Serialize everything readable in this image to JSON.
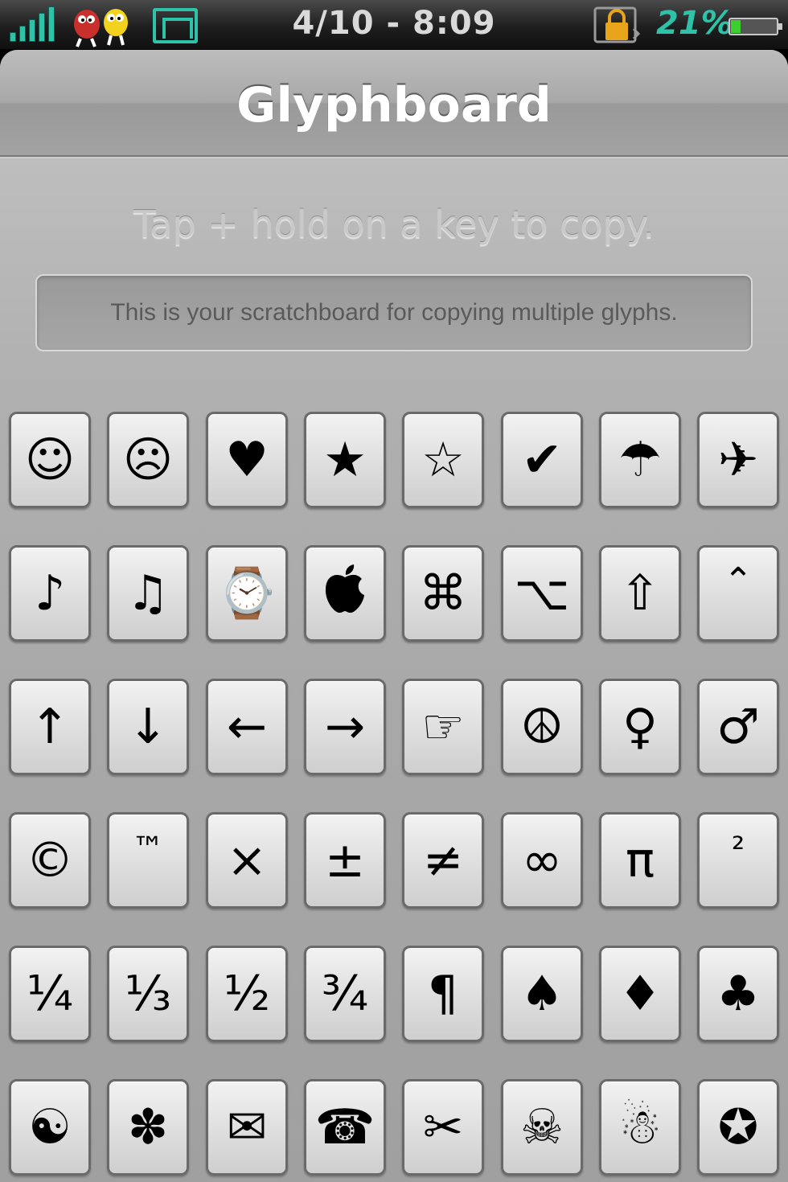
{
  "status_bar": {
    "time": "4/10 - 8:09",
    "battery_percent_text": "21%",
    "battery_level": 0.21,
    "icons": [
      "signal-bars-icon",
      "mm-characters-icon",
      "screen-mirror-icon",
      "lock-rotation-icon",
      "battery-icon"
    ],
    "accent_color": "#2ec2a8"
  },
  "app": {
    "title": "Glyphboard",
    "hint": "Tap + hold on a key to copy.",
    "scratchboard_placeholder": "This is your scratchboard for copying multiple glyphs."
  },
  "keys": [
    [
      "☺",
      "☹",
      "♥",
      "★",
      "☆",
      "✔",
      "☂",
      "✈"
    ],
    [
      "♪",
      "♫",
      "⌚",
      "",
      "⌘",
      "⌥",
      "⇧",
      "⌃"
    ],
    [
      "↑",
      "↓",
      "←",
      "→",
      "☞",
      "☮",
      "♀",
      "♂"
    ],
    [
      "©",
      "™",
      "×",
      "±",
      "≠",
      "∞",
      "π",
      "²"
    ],
    [
      "¼",
      "⅓",
      "½",
      "¾",
      "¶",
      "♠",
      "♦",
      "♣"
    ],
    [
      "☯",
      "✽",
      "✉",
      "☎",
      "✂",
      "☠",
      "☃",
      "✪"
    ]
  ],
  "key_names": [
    [
      "smile-face",
      "frown-face",
      "heart",
      "black-star",
      "white-star",
      "check-mark",
      "umbrella",
      "airplane"
    ],
    [
      "eighth-note",
      "beamed-notes",
      "watch",
      "apple-logo",
      "command",
      "option",
      "shift-arrow",
      "control-caret"
    ],
    [
      "up-arrow",
      "down-arrow",
      "left-arrow",
      "right-arrow",
      "pointing-hand",
      "peace-sign",
      "female-sign",
      "male-sign"
    ],
    [
      "copyright",
      "trademark",
      "multiply",
      "plus-minus",
      "not-equal",
      "infinity",
      "pi",
      "superscript-two"
    ],
    [
      "one-quarter",
      "one-third",
      "one-half",
      "three-quarters",
      "pilcrow",
      "spade",
      "diamond",
      "club"
    ],
    [
      "yin-yang",
      "flower",
      "envelope",
      "telephone",
      "scissors",
      "skull-crossbones",
      "snowman",
      "circled-star"
    ]
  ]
}
